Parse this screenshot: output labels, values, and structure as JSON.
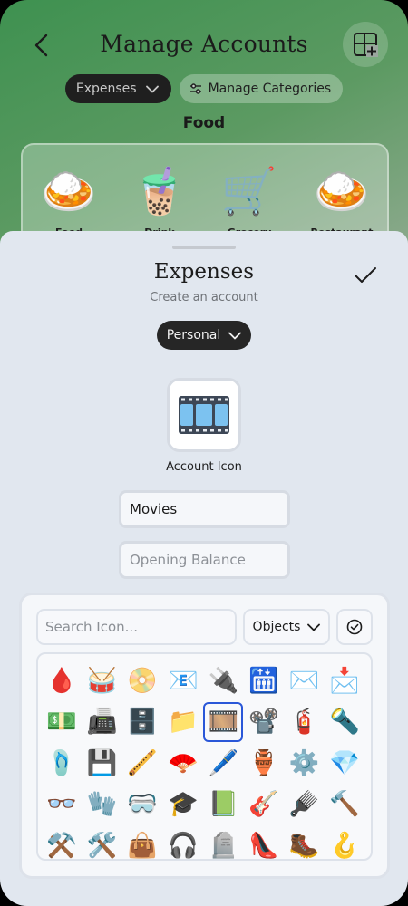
{
  "header": {
    "title": "Manage Accounts"
  },
  "filters": {
    "type_label": "Expenses",
    "manage_label": "Manage Categories"
  },
  "section": {
    "title": "Food"
  },
  "categories": [
    {
      "label": "Food",
      "emoji": "🍛"
    },
    {
      "label": "Drink",
      "emoji": "🧋"
    },
    {
      "label": "Grocery",
      "emoji": "🛒"
    },
    {
      "label": "Restaurant",
      "emoji": "🍛"
    }
  ],
  "sheet": {
    "title": "Expenses",
    "subtitle": "Create an account",
    "owner_label": "Personal",
    "icon_caption": "Account Icon",
    "selected_icon": "🎞️",
    "name_value": "Movies",
    "balance_placeholder": "Opening Balance"
  },
  "picker": {
    "search_placeholder": "Search Icon...",
    "category_label": "Objects",
    "selected_index": 12,
    "icons": [
      "🩸",
      "🥁",
      "📀",
      "📧",
      "🔌",
      "🛗",
      "✉️",
      "📩",
      "💵",
      "📠",
      "🗄️",
      "📁",
      "🎞️",
      "📽️",
      "🧯",
      "🔦",
      "🩴",
      "💾",
      "🪈",
      "🪭",
      "🖊️",
      "🏺",
      "⚙️",
      "💎",
      "👓",
      "🧤",
      "🥽",
      "🎓",
      "📗",
      "🎸",
      "🪮",
      "🔨",
      "⚒️",
      "🛠️",
      "👜",
      "🎧",
      "🪦",
      "👠",
      "🥾",
      "🪝"
    ]
  },
  "colors": {
    "accent": "#2a57d8",
    "sheet_bg": "#e1e7ef",
    "dark_pill": "#262626"
  }
}
